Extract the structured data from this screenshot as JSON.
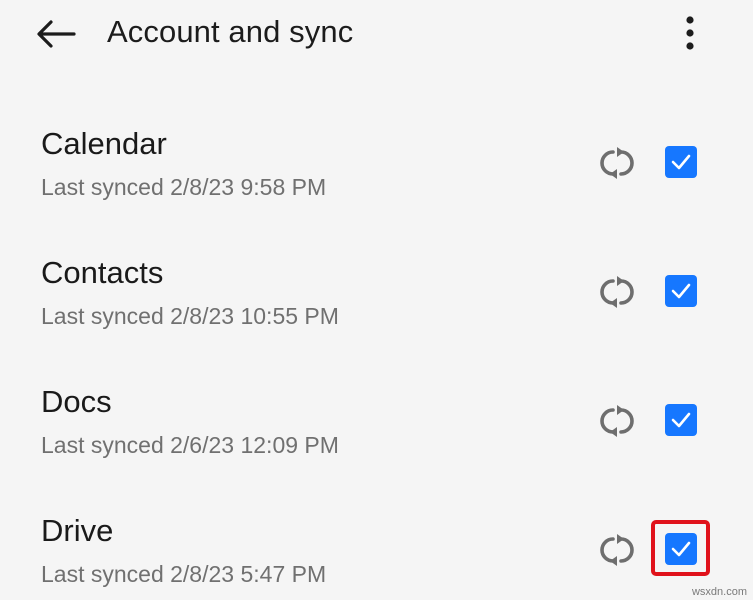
{
  "appbar": {
    "title": "Account and sync",
    "back_icon": "arrow-left-icon",
    "overflow_icon": "more-vert-icon"
  },
  "items": [
    {
      "name": "Calendar",
      "last_synced": "Last synced 2/8/23 9:58 PM",
      "checked": true,
      "highlighted": false
    },
    {
      "name": "Contacts",
      "last_synced": "Last synced 2/8/23 10:55 PM",
      "checked": true,
      "highlighted": false
    },
    {
      "name": "Docs",
      "last_synced": "Last synced 2/6/23 12:09 PM",
      "checked": true,
      "highlighted": false
    },
    {
      "name": "Drive",
      "last_synced": "Last synced 2/8/23 5:47 PM",
      "checked": true,
      "highlighted": true
    }
  ],
  "colors": {
    "accent": "#1677ff",
    "highlight": "#e0121b",
    "background": "#f5f5f5",
    "icon_gray": "#6e6e6e"
  },
  "watermark": "wsxdn.com"
}
